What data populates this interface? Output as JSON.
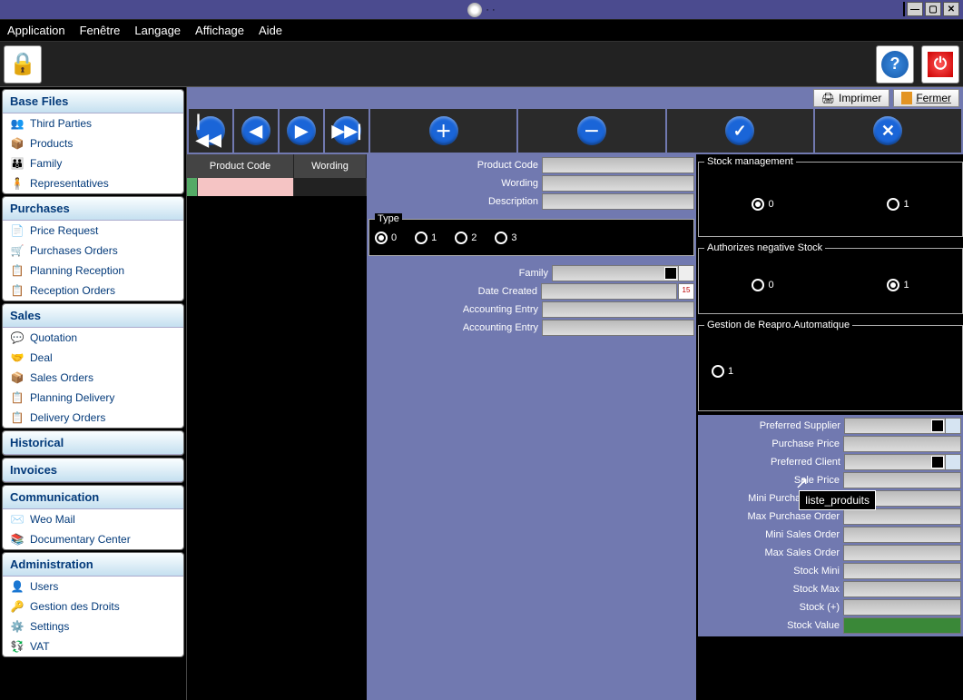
{
  "title": "· ·",
  "menu": {
    "application": "Application",
    "fenetre": "Fenêtre",
    "langage": "Langage",
    "affichage": "Affichage",
    "aide": "Aide"
  },
  "toolbar": {
    "print": "Imprimer",
    "close": "Fermer"
  },
  "sidebar": [
    {
      "head": "Base Files",
      "items": [
        {
          "ic": "👥",
          "label": "Third Parties"
        },
        {
          "ic": "📦",
          "label": "Products"
        },
        {
          "ic": "👪",
          "label": "Family"
        },
        {
          "ic": "🧍",
          "label": "Representatives"
        }
      ]
    },
    {
      "head": "Purchases",
      "items": [
        {
          "ic": "📄",
          "label": "Price Request"
        },
        {
          "ic": "🛒",
          "label": "Purchases Orders"
        },
        {
          "ic": "📋",
          "label": "Planning Reception"
        },
        {
          "ic": "📋",
          "label": "Reception Orders"
        }
      ]
    },
    {
      "head": "Sales",
      "items": [
        {
          "ic": "💬",
          "label": "Quotation"
        },
        {
          "ic": "🤝",
          "label": "Deal"
        },
        {
          "ic": "📦",
          "label": "Sales Orders"
        },
        {
          "ic": "📋",
          "label": "Planning Delivery"
        },
        {
          "ic": "📋",
          "label": "Delivery Orders"
        }
      ]
    },
    {
      "head": "Historical",
      "items": []
    },
    {
      "head": "Invoices",
      "items": []
    },
    {
      "head": "Communication",
      "items": [
        {
          "ic": "✉️",
          "label": "Weo Mail"
        },
        {
          "ic": "📚",
          "label": "Documentary Center"
        }
      ]
    },
    {
      "head": "Administration",
      "items": [
        {
          "ic": "👤",
          "label": "Users"
        },
        {
          "ic": "🔑",
          "label": "Gestion des Droits"
        },
        {
          "ic": "⚙️",
          "label": "Settings"
        },
        {
          "ic": "💱",
          "label": "VAT"
        }
      ]
    }
  ],
  "table": {
    "col1": "Product Code",
    "col2": "Wording"
  },
  "form_mid": {
    "product_code": "Product Code",
    "wording": "Wording",
    "description": "Description",
    "type_legend": "Type",
    "type_opts": [
      "0",
      "1",
      "2",
      "3"
    ],
    "family": "Family",
    "date_created": "Date Created",
    "accounting_entry1": "Accounting Entry",
    "accounting_entry2": "Accounting Entry"
  },
  "form_right": {
    "stock_mgmt": "Stock management",
    "stock_opts": [
      "0",
      "1"
    ],
    "neg_stock": "Authorizes negative Stock",
    "neg_opts": [
      "0",
      "1"
    ],
    "reappro": "Gestion de Reapro.Automatique",
    "reappro_opts": [
      "1"
    ],
    "tooltip": "liste_produits",
    "fields": [
      "Preferred Supplier",
      "Purchase Price",
      "Preferred Client",
      "Sale Price",
      "Mini Purchase Order",
      "Max Purchase Order",
      "Mini Sales Order",
      "Max Sales Order",
      "Stock Mini",
      "Stock Max",
      "Stock (+)",
      "Stock Value"
    ]
  }
}
